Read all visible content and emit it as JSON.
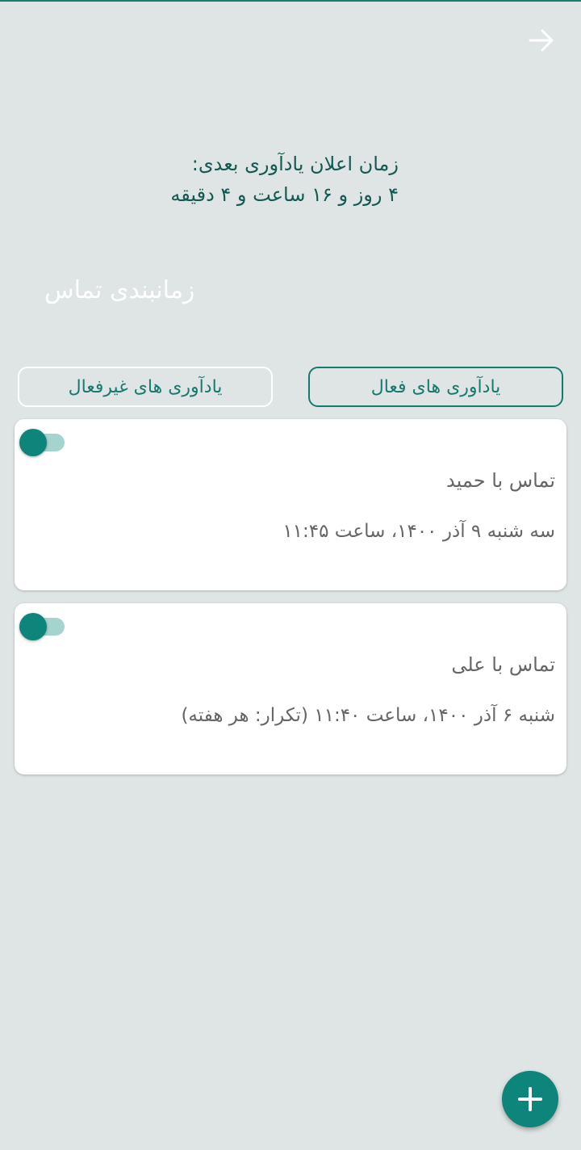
{
  "header": {
    "next_reminder_label": "زمان اعلان یادآوری بعدی:",
    "next_reminder_value": "۴ روز و ۱۶ ساعت و ۴ دقیقه",
    "page_title": "زمانبندی تماس"
  },
  "tabs": {
    "active_label": "یادآوری های فعال",
    "inactive_label": "یادآوری های غیرفعال"
  },
  "reminders": [
    {
      "name": "تماس با حمید",
      "datetime": "سه شنبه ۹ آذر ۱۴۰۰، ساعت ۱۱:۴۵",
      "enabled": true
    },
    {
      "name": "تماس با علی",
      "datetime": "شنبه ۶ آذر ۱۴۰۰، ساعت ۱۱:۴۰ (تکرار: هر هفته)",
      "enabled": true
    }
  ],
  "icons": {
    "back": "arrow-right-icon",
    "add": "plus-icon"
  },
  "colors": {
    "accent": "#0d857a",
    "background": "#dfe4e4",
    "heading_text": "#155a52"
  }
}
